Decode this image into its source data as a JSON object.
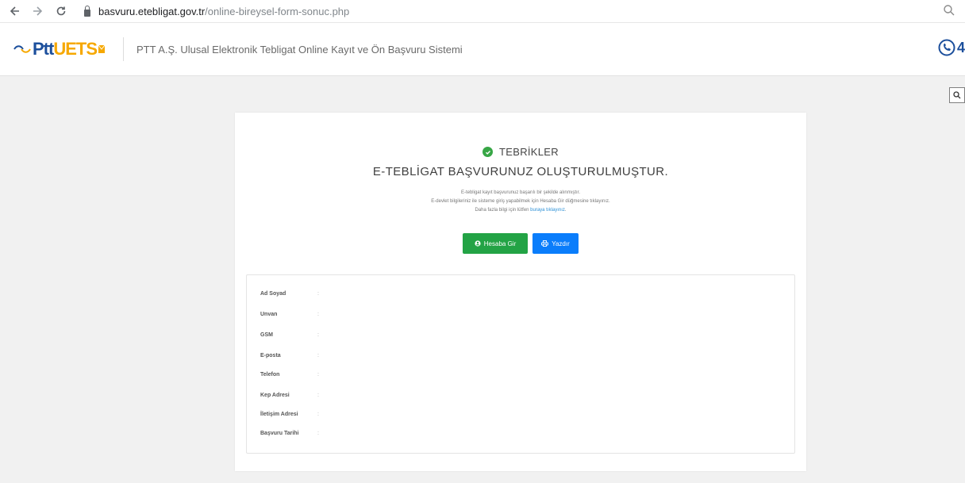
{
  "browser": {
    "url_host": "basvuru.etebligat.gov.tr",
    "url_path": "/online-bireysel-form-sonuc.php"
  },
  "header": {
    "logo_ptt": "Ptt",
    "logo_uets": "UETS",
    "title": "PTT A.Ş. Ulusal Elektronik Tebligat Online Kayıt ve Ön Başvuru Sistemi",
    "phone_partial": "4",
    "brand_blue": "#1c4f9c",
    "brand_yellow": "#f6a800"
  },
  "result": {
    "heading": "TEBRİKLER",
    "subheading": "E-TEBLİGAT BAŞVURUNUZ OLUŞTURULMUŞTUR.",
    "info_line1": "E-tebligat kayıt başvurunuz başarılı bir şekilde alınmıştır.",
    "info_line2": "E-devlet bilgileriniz ile sisteme giriş yapabilmek için Hesaba Gir düğmesine tıklayınız.",
    "info_line3_prefix": "Daha fazla bilgi için lütfen ",
    "info_line3_link": "buraya tıklayınız",
    "info_line3_suffix": ".",
    "success_color": "#37a645"
  },
  "buttons": {
    "login_label": "Hesaba Gir",
    "print_label": "Yazdır",
    "login_color": "#23a345",
    "print_color": "#0a7dfb"
  },
  "details": [
    {
      "label": "Ad Soyad",
      "value": ""
    },
    {
      "label": "Unvan",
      "value": ""
    },
    {
      "label": "GSM",
      "value": ""
    },
    {
      "label": "E-posta",
      "value": ""
    },
    {
      "label": "Telefon",
      "value": ""
    },
    {
      "label": "Kep Adresi",
      "value": ""
    },
    {
      "label": "İletişim Adresi",
      "value": ""
    },
    {
      "label": "Başvuru Tarihi",
      "value": ""
    }
  ],
  "separator": ":"
}
